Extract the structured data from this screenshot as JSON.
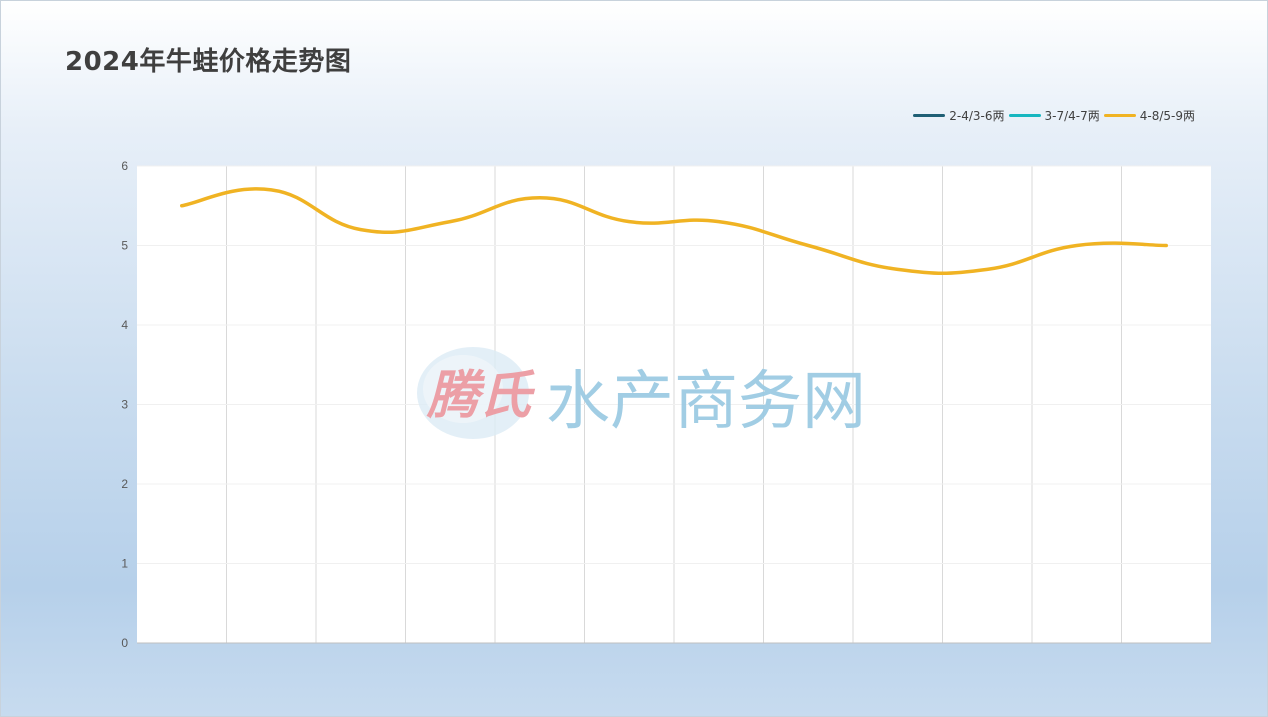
{
  "header": {
    "title": "2024年牛蛙价格走势图"
  },
  "watermark": {
    "brand": "腾氏",
    "site": "水产商务网"
  },
  "chart_data": {
    "type": "line",
    "title": "2024年牛蛙价格走势图",
    "xlabel": "",
    "ylabel": "",
    "ylim": [
      0,
      6
    ],
    "yticks": [
      0,
      1,
      2,
      3,
      4,
      5,
      6
    ],
    "x": [
      1,
      2,
      3,
      4,
      5,
      6,
      7,
      8,
      9,
      10,
      11,
      12
    ],
    "grid": {
      "vertical": true,
      "horizontal": true
    },
    "legend_position": "top-right",
    "series": [
      {
        "name": "2-4/3-6两",
        "color": "#1f5f75",
        "values": []
      },
      {
        "name": "3-7/4-7两",
        "color": "#16b6c0",
        "values": []
      },
      {
        "name": "4-8/5-9两",
        "color": "#f0b323",
        "values": [
          5.5,
          5.7,
          5.2,
          5.3,
          5.6,
          5.3,
          5.3,
          5.0,
          4.7,
          4.7,
          5.0,
          5.0
        ]
      }
    ]
  }
}
